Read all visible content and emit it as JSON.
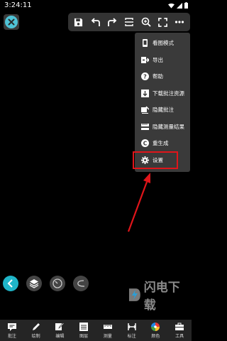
{
  "status": {
    "time": "3:24:11"
  },
  "menu": {
    "items": [
      {
        "label": "看图模式",
        "icon": "phone-view-icon"
      },
      {
        "label": "导出",
        "icon": "export-icon"
      },
      {
        "label": "帮助",
        "icon": "help-icon"
      },
      {
        "label": "下载批注资源",
        "icon": "download-icon"
      },
      {
        "label": "隐藏批注",
        "icon": "hide-annotation-icon"
      },
      {
        "label": "隐藏测量结果",
        "icon": "hide-measure-icon"
      },
      {
        "label": "重生成",
        "icon": "regenerate-icon"
      },
      {
        "label": "设置",
        "icon": "gear-icon"
      }
    ],
    "highlighted": "设置",
    "highlight_color": "#e0151a"
  },
  "bottom_bar": {
    "items": [
      {
        "label": "批注",
        "icon": "annotation-icon"
      },
      {
        "label": "绘制",
        "icon": "pen-icon"
      },
      {
        "label": "编辑",
        "icon": "edit-icon"
      },
      {
        "label": "图层",
        "icon": "layers-icon"
      },
      {
        "label": "测量",
        "icon": "ruler-icon"
      },
      {
        "label": "标注",
        "icon": "dimension-icon"
      },
      {
        "label": "颜色",
        "icon": "color-icon"
      },
      {
        "label": "工具",
        "icon": "toolbox-icon"
      }
    ]
  },
  "watermark": {
    "text": "闪电下载"
  },
  "colors": {
    "accent": "#1fb5c8",
    "background": "#000000",
    "menu_bg": "#3a3a3a",
    "arrow": "#e0151a"
  }
}
